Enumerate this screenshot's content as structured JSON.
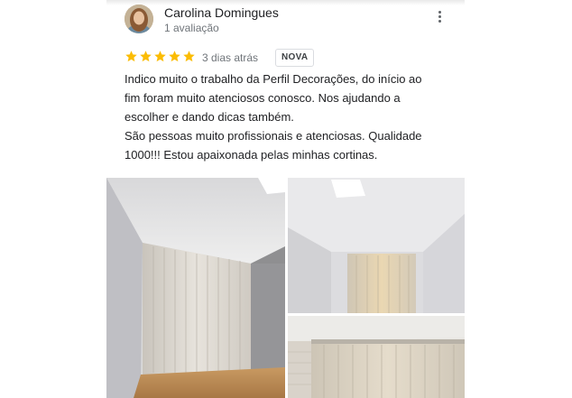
{
  "review": {
    "author_name": "Carolina Domingues",
    "author_meta": "1 avaliação",
    "rating": 5,
    "rating_max": 5,
    "time_ago": "3 dias atrás",
    "badge": "NOVA",
    "text_lines": [
      "Indico muito o trabalho da Perfil Decorações, do início ao",
      "fim foram muito atenciosos conosco. Nos ajudando a",
      "escolher e dando dicas também.",
      "São pessoas muito profissionais e atenciosas. Qualidade",
      "1000!!! Estou apaixonada pelas minhas cortinas."
    ],
    "photo_count": 3
  },
  "colors": {
    "star": "#fbbc04",
    "text": "#202124",
    "secondary_text": "#70757a"
  },
  "icons": {
    "more": "more-vert-icon",
    "star": "star-icon"
  }
}
